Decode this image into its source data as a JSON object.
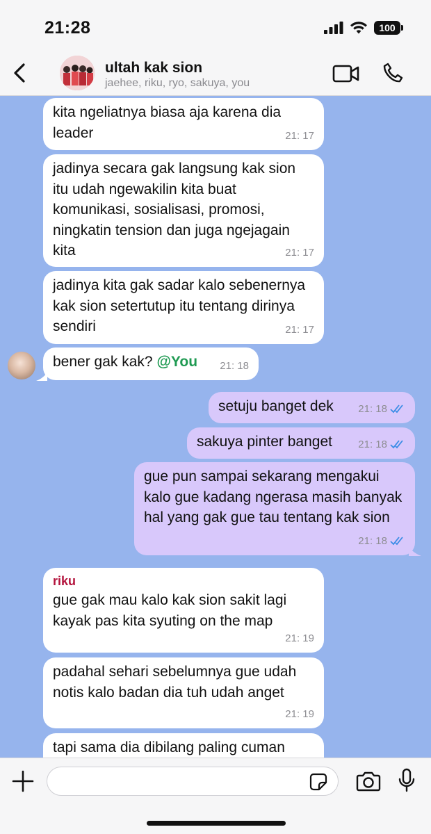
{
  "status": {
    "time": "21:28",
    "battery": "100"
  },
  "header": {
    "title": "ultah kak sion",
    "members": "jaehee, riku, ryo, sakuya, you",
    "icons": {
      "back": "chevron-left-icon",
      "video": "video-call-icon",
      "call": "phone-icon"
    }
  },
  "messages": [
    {
      "direction": "incoming",
      "text": "kita ngeliatnya biasa aja karena dia leader",
      "time": "21: 17"
    },
    {
      "direction": "incoming",
      "text": "jadinya secara gak langsung kak sion itu udah ngewakilin kita buat komunikasi, sosialisasi, promosi, ningkatin tension dan juga ngejagain kita",
      "time": "21: 17"
    },
    {
      "direction": "incoming",
      "text": "jadinya kita gak sadar kalo sebenernya kak sion setertutup itu tentang dirinya sendiri",
      "time": "21: 17"
    },
    {
      "direction": "incoming",
      "text": "bener gak kak?",
      "mention": "@You",
      "time": "21: 18"
    },
    {
      "direction": "outgoing",
      "text": "setuju banget dek",
      "time": "21: 18",
      "read": true
    },
    {
      "direction": "outgoing",
      "text": "sakuya pinter banget",
      "time": "21: 18",
      "read": true
    },
    {
      "direction": "outgoing",
      "text": "gue pun sampai sekarang mengakui kalo gue kadang ngerasa masih banyak hal yang gak gue tau tentang kak sion",
      "time": "21: 18",
      "read": true
    },
    {
      "direction": "incoming",
      "sender": "riku",
      "text": "gue gak mau kalo kak sion sakit lagi kayak pas kita syuting on the map",
      "time": "21: 19"
    },
    {
      "direction": "incoming",
      "text": "padahal sehari sebelumnya gue udah notis kalo badan dia tuh udah anget",
      "time": "21: 19"
    },
    {
      "direction": "incoming",
      "text": "tapi sama dia dibilang paling cuman"
    }
  ],
  "composer": {
    "value": "",
    "icons": {
      "add": "plus-icon",
      "sticker": "sticker-icon",
      "camera": "camera-icon",
      "mic": "microphone-icon"
    }
  },
  "colors": {
    "chat_bg": "#96b4ed",
    "incoming": "#ffffff",
    "outgoing": "#d8c8fb",
    "read_ticks": "#3b8de6",
    "sender": "#b3133c",
    "mention": "#1f9a52"
  }
}
